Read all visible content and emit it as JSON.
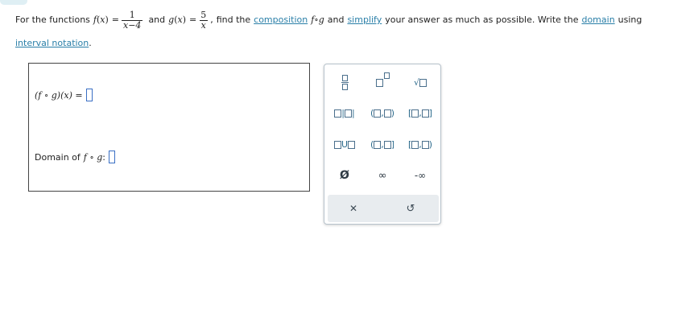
{
  "problem": {
    "intro": "For the functions",
    "f_name": "f",
    "x_var": "x",
    "equals": "=",
    "f_num": "1",
    "f_den": "x−4",
    "and_text": "and",
    "g_name": "g",
    "g_num": "5",
    "g_den": "x",
    "comma": ",",
    "find_text": "find the",
    "composition_link": "composition",
    "fog": "f∘g",
    "and_text2": "and",
    "simplify_link": "simplify",
    "mid_text": "your answer as much as possible. Write the",
    "domain_link": "domain",
    "using_text": "using",
    "interval_link": "interval notation",
    "period": "."
  },
  "answer": {
    "composition_label": "(f ∘ g)(x) =",
    "domain_label": "Domain of",
    "domain_fog": "f ∘ g",
    "colon": ":"
  },
  "palette": {
    "paren_open": "(",
    "paren_close": ")",
    "bracket_open": "[",
    "bracket_close": "]",
    "comma": ",",
    "union": "U",
    "empty_set": "Ø",
    "infinity": "∞",
    "neg_infinity": "-∞",
    "clear": "✕",
    "undo": "↺"
  },
  "colors": {
    "link": "#2a7fa8",
    "input_border": "#3a6fc4",
    "palette_icon": "#4a6f8c",
    "palette_bottom": "#e8ecef"
  }
}
